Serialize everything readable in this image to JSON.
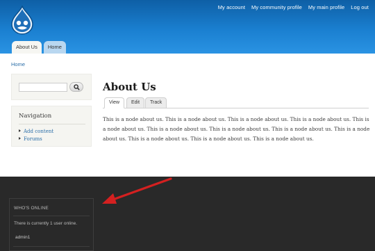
{
  "header": {
    "secondary_menu": [
      "My account",
      "My community profile",
      "My main profile",
      "Log out"
    ],
    "primary_tabs": [
      {
        "label": "About Us",
        "active": true
      },
      {
        "label": "Home",
        "active": false
      }
    ],
    "logo_icon": "drupal-drop-icon"
  },
  "breadcrumb": "Home",
  "sidebar": {
    "search": {
      "input_value": "",
      "button_icon": "search-icon"
    },
    "navigation": {
      "title": "Navigation",
      "items": [
        "Add content",
        "Forums"
      ]
    }
  },
  "main": {
    "title": "About Us",
    "tabs": [
      {
        "label": "View",
        "active": true
      },
      {
        "label": "Edit",
        "active": false
      },
      {
        "label": "Track",
        "active": false
      }
    ],
    "body": "This is a node about us. This is a node about us. This is a node about us. This is a node about us. This is a node about us. This is a node about us. This is a node about us. This is a node about us. This is a node about us. This is a node about us. This is a node about us. This is a node about us."
  },
  "footer": {
    "whos_online": {
      "title": "WHO'S ONLINE",
      "text": "There is currently 1 user online.",
      "users": [
        "admin1"
      ]
    }
  },
  "annotation": {
    "icon": "red-arrow-icon",
    "color": "#d42020"
  },
  "colors": {
    "header_blue": "#1a7fd0",
    "footer_bg": "#292929",
    "link": "#2b6ea8"
  }
}
